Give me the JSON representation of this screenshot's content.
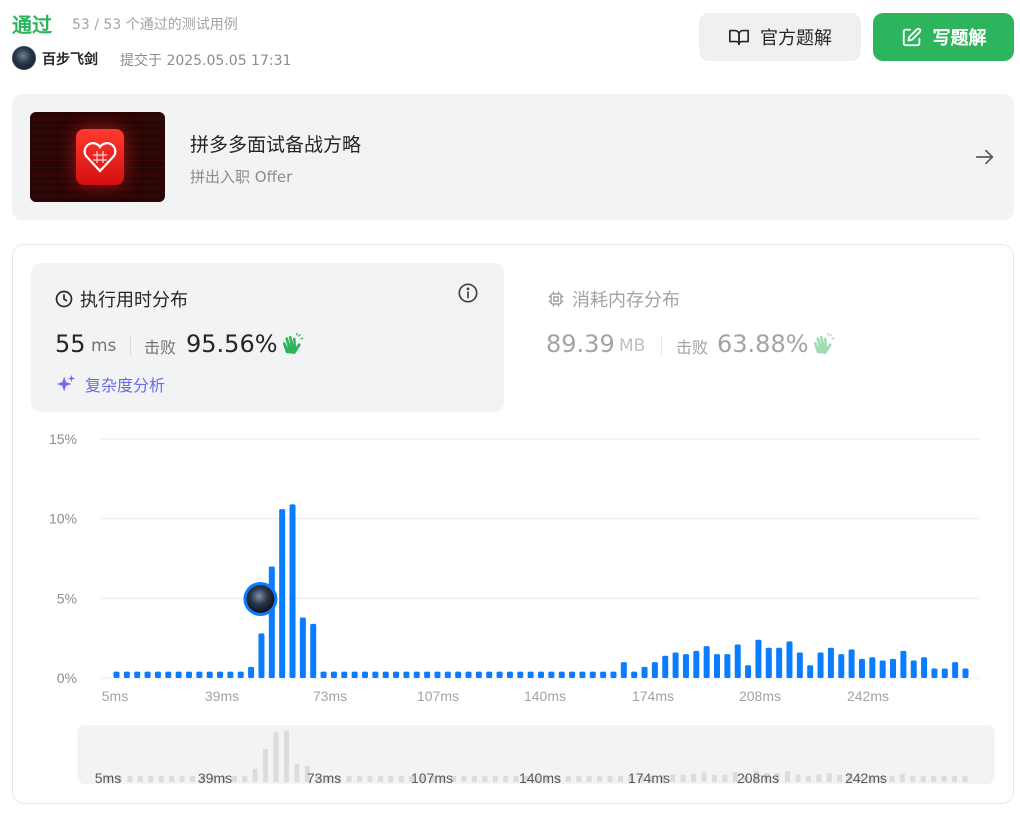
{
  "header": {
    "status": "通过",
    "count": "53 / 53 个通过的测试用例",
    "user_name": "百步飞剑",
    "submit_time": "提交于 2025.05.05 17:31"
  },
  "buttons": {
    "official": "官方题解",
    "write": "写题解"
  },
  "promo": {
    "title": "拼多多面试备战方略",
    "subtitle": "拼出入职 Offer"
  },
  "runtime": {
    "title": "执行用时分布",
    "value": "55",
    "unit": "ms",
    "beat_label": "击败",
    "beat": "95.56%",
    "complexity": "复杂度分析"
  },
  "memory": {
    "title": "消耗内存分布",
    "value": "89.39",
    "unit": "MB",
    "beat_label": "击败",
    "beat": "63.88%"
  },
  "colors": {
    "accent_green": "#2db55d",
    "bar_blue": "#0a7cff",
    "mini_bar": "#dcdcdc"
  },
  "chart_data": {
    "type": "bar",
    "yticks": [
      "15%",
      "10%",
      "5%",
      "0%"
    ],
    "ylim": [
      0,
      15
    ],
    "xticks": [
      "5ms",
      "39ms",
      "73ms",
      "107ms",
      "140ms",
      "174ms",
      "208ms",
      "242ms"
    ],
    "xlabel": "",
    "ylabel": "",
    "grid": true,
    "values": [
      0.4,
      0.4,
      0.4,
      0.4,
      0.4,
      0.4,
      0.4,
      0.4,
      0.4,
      0.4,
      0.4,
      0.4,
      0.4,
      0.7,
      2.8,
      7.0,
      10.6,
      10.9,
      3.8,
      3.4,
      0.4,
      0.4,
      0.4,
      0.4,
      0.4,
      0.4,
      0.4,
      0.4,
      0.4,
      0.4,
      0.4,
      0.4,
      0.4,
      0.4,
      0.4,
      0.4,
      0.4,
      0.4,
      0.4,
      0.4,
      0.4,
      0.4,
      0.4,
      0.4,
      0.4,
      0.4,
      0.4,
      0.4,
      0.4,
      1.0,
      0.4,
      0.7,
      1.0,
      1.4,
      1.6,
      1.5,
      1.7,
      2.0,
      1.5,
      1.5,
      2.1,
      0.8,
      2.4,
      1.9,
      1.9,
      2.3,
      1.6,
      0.8,
      1.6,
      1.9,
      1.5,
      1.8,
      1.2,
      1.3,
      1.1,
      1.2,
      1.7,
      1.1,
      1.3,
      0.6,
      0.6,
      1.0,
      0.6
    ],
    "marker_index": 14,
    "mini_xticks": [
      "5ms",
      "39ms",
      "73ms",
      "107ms",
      "140ms",
      "174ms",
      "208ms",
      "242ms"
    ]
  }
}
